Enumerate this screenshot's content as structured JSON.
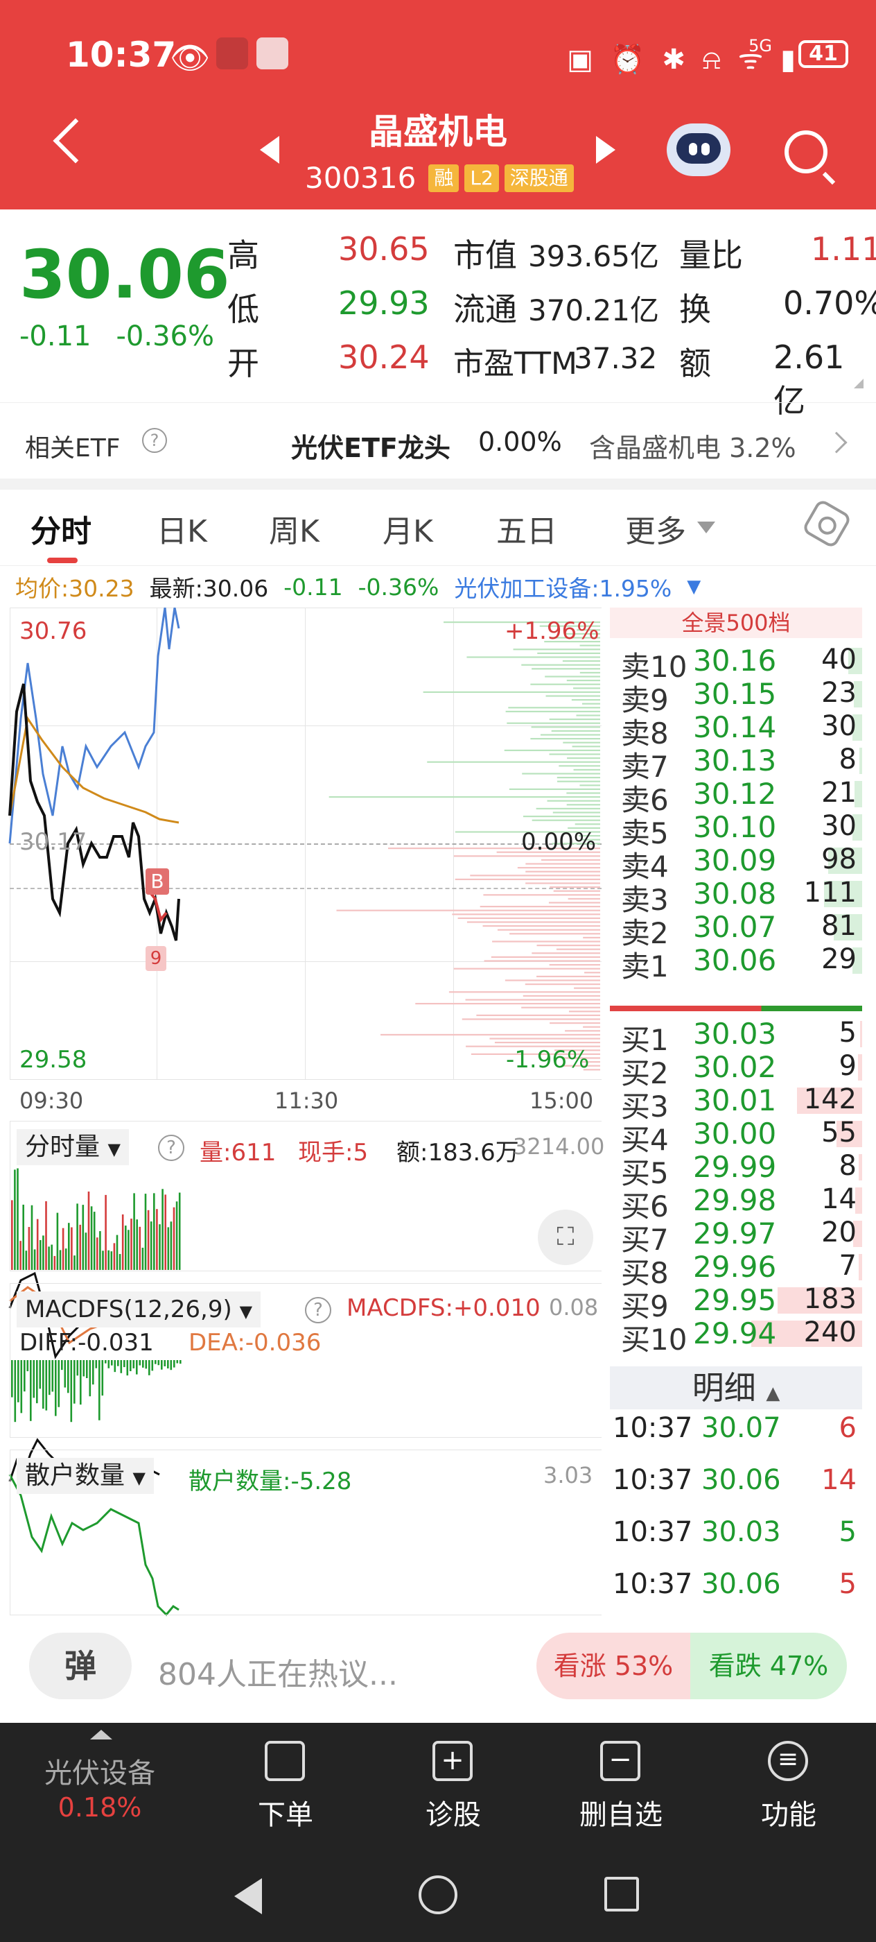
{
  "status_bar": {
    "time": "10:37",
    "battery": "41",
    "network": "5G"
  },
  "header": {
    "stock_name": "晶盛机电",
    "stock_code": "300316",
    "tags": [
      "融",
      "L2",
      "深股通"
    ]
  },
  "quote": {
    "price": "30.06",
    "change": "-0.11",
    "change_pct": "-0.36%",
    "stats": [
      {
        "label": "高",
        "value": "30.65",
        "color": "red"
      },
      {
        "label": "低",
        "value": "29.93",
        "color": "green"
      },
      {
        "label": "开",
        "value": "30.24",
        "color": "red"
      }
    ],
    "stats2": [
      {
        "label": "市值",
        "value": "393.65亿"
      },
      {
        "label": "流通",
        "value": "370.21亿"
      },
      {
        "label": "市盈TTM",
        "value": "37.32"
      }
    ],
    "stats3": [
      {
        "label": "量比",
        "value": "1.11",
        "color": "red"
      },
      {
        "label": "换",
        "value": "0.70%",
        "color": "black"
      },
      {
        "label": "额",
        "value": "2.61亿",
        "color": "black"
      }
    ]
  },
  "etf": {
    "label": "相关ETF",
    "name": "光伏ETF龙头",
    "change": "0.00%",
    "holding": "含晶盛机电 3.2%"
  },
  "tabs": [
    "分时",
    "日K",
    "周K",
    "月K",
    "五日",
    "更多"
  ],
  "info_bar": {
    "avg": "均价:30.23",
    "latest": "最新:30.06",
    "chg": "-0.11",
    "pct": "-0.36%",
    "sector": "光伏加工设备:1.95%"
  },
  "chart": {
    "high_price": "30.76",
    "low_price": "29.58",
    "mid_price": "30.17",
    "high_pct": "+1.96%",
    "low_pct": "-1.96%",
    "mid_pct": "0.00%",
    "times": [
      "09:30",
      "11:30",
      "15:00"
    ],
    "marker_b": "B",
    "marker_num": "9"
  },
  "volume_panel": {
    "title": "分时量",
    "vol": "量:611",
    "hand": "现手:5",
    "amount": "额:183.6万",
    "max": "3214.00"
  },
  "macd_panel": {
    "title": "MACDFS(12,26,9)",
    "macd": "MACDFS:+0.010",
    "diff": "DIFF:-0.031",
    "dea": "DEA:-0.036",
    "max": "0.08"
  },
  "retail_panel": {
    "title": "散户数量",
    "value": "散户数量:-5.28",
    "max": "3.03"
  },
  "order_book": {
    "header": "全景500档",
    "asks": [
      {
        "label": "卖10",
        "price": "30.16",
        "vol": "40",
        "frac": 0.17
      },
      {
        "label": "卖9",
        "price": "30.15",
        "vol": "23",
        "frac": 0.1
      },
      {
        "label": "卖8",
        "price": "30.14",
        "vol": "30",
        "frac": 0.12
      },
      {
        "label": "卖7",
        "price": "30.13",
        "vol": "8",
        "frac": 0.03
      },
      {
        "label": "卖6",
        "price": "30.12",
        "vol": "21",
        "frac": 0.09
      },
      {
        "label": "卖5",
        "price": "30.10",
        "vol": "30",
        "frac": 0.12
      },
      {
        "label": "卖4",
        "price": "30.09",
        "vol": "98",
        "frac": 0.41
      },
      {
        "label": "卖3",
        "price": "30.08",
        "vol": "111",
        "frac": 0.46
      },
      {
        "label": "卖2",
        "price": "30.07",
        "vol": "81",
        "frac": 0.34
      },
      {
        "label": "卖1",
        "price": "30.06",
        "vol": "29",
        "frac": 0.12
      }
    ],
    "bids": [
      {
        "label": "买1",
        "price": "30.03",
        "vol": "5",
        "frac": 0.02
      },
      {
        "label": "买2",
        "price": "30.02",
        "vol": "9",
        "frac": 0.04
      },
      {
        "label": "买3",
        "price": "30.01",
        "vol": "142",
        "frac": 0.59
      },
      {
        "label": "买4",
        "price": "30.00",
        "vol": "55",
        "frac": 0.23
      },
      {
        "label": "买5",
        "price": "29.99",
        "vol": "8",
        "frac": 0.03
      },
      {
        "label": "买6",
        "price": "29.98",
        "vol": "14",
        "frac": 0.06
      },
      {
        "label": "买7",
        "price": "29.97",
        "vol": "20",
        "frac": 0.08
      },
      {
        "label": "买8",
        "price": "29.96",
        "vol": "7",
        "frac": 0.03
      },
      {
        "label": "买9",
        "price": "29.95",
        "vol": "183",
        "frac": 0.76
      },
      {
        "label": "买10",
        "price": "29.94",
        "vol": "240",
        "frac": 1.0
      }
    ],
    "detail_title": "明细",
    "trades": [
      {
        "time": "10:37",
        "price": "30.07",
        "vol": "6",
        "dir": "buy"
      },
      {
        "time": "10:37",
        "price": "30.06",
        "vol": "14",
        "dir": "buy"
      },
      {
        "time": "10:37",
        "price": "30.03",
        "vol": "5",
        "dir": "sell"
      },
      {
        "time": "10:37",
        "price": "30.06",
        "vol": "5",
        "dir": "buy"
      }
    ]
  },
  "discussion": {
    "danmu": "弹",
    "text": "804人正在热议...",
    "bull": "看涨 53%",
    "bear": "看跌 47%"
  },
  "toolbar": {
    "sector_name": "光伏设备",
    "sector_chg": "0.18%",
    "items": [
      "下单",
      "诊股",
      "删自选",
      "功能"
    ]
  }
}
